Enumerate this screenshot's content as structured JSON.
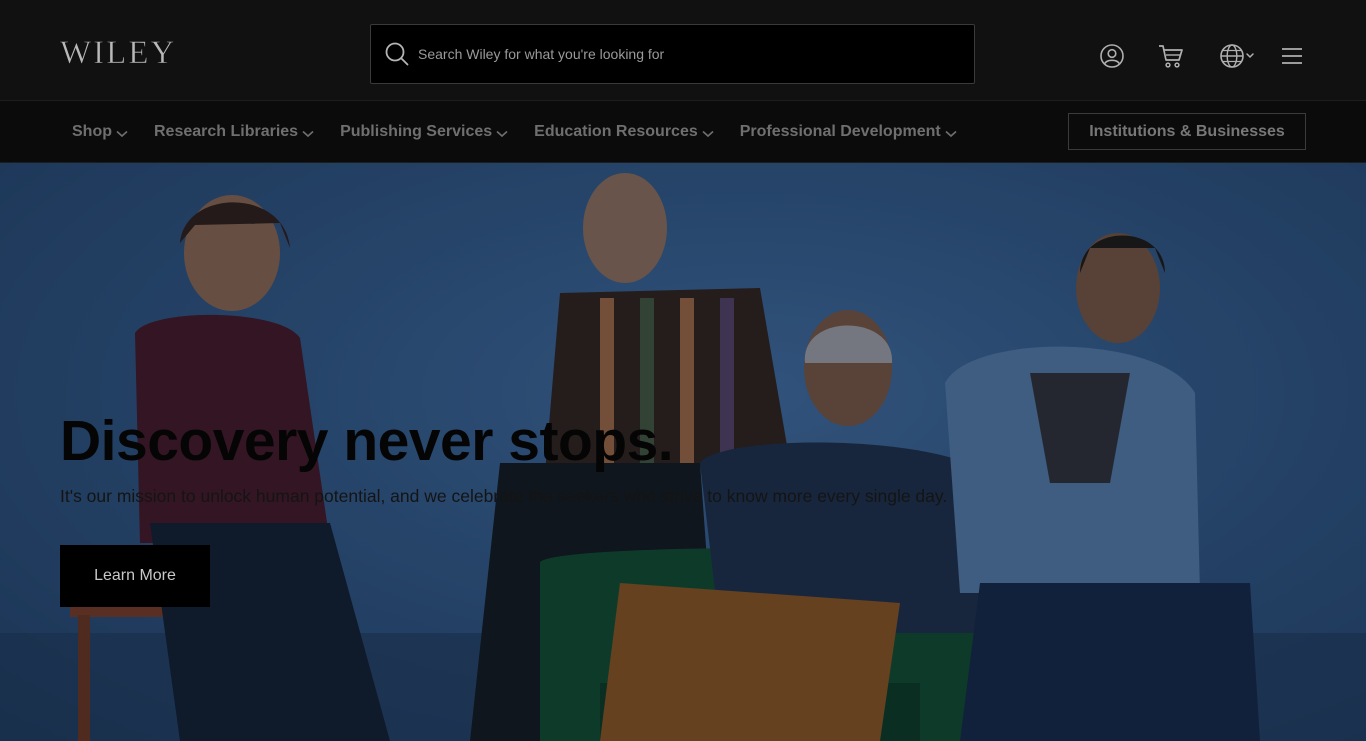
{
  "header": {
    "logo_text": "WILEY",
    "search": {
      "placeholder": "Search Wiley for what you're looking for",
      "value": ""
    },
    "icons": [
      "account-icon",
      "cart-icon",
      "globe-icon",
      "menu-icon"
    ]
  },
  "nav": {
    "items": [
      {
        "label": "Shop"
      },
      {
        "label": "Research Libraries"
      },
      {
        "label": "Publishing Services"
      },
      {
        "label": "Education Resources"
      },
      {
        "label": "Professional Development"
      }
    ],
    "cta_label": "Institutions & Businesses"
  },
  "hero": {
    "title": "Discovery never stops.",
    "subtitle": "It's our mission to unlock human potential, and we celebrate the seekers who strive to know more every single day.",
    "button_label": "Learn More"
  },
  "colors": {
    "header_bg": "#111111",
    "nav_bg": "#0b0b0b",
    "hero_bg": "#2c4d75",
    "button_bg": "#000000"
  }
}
